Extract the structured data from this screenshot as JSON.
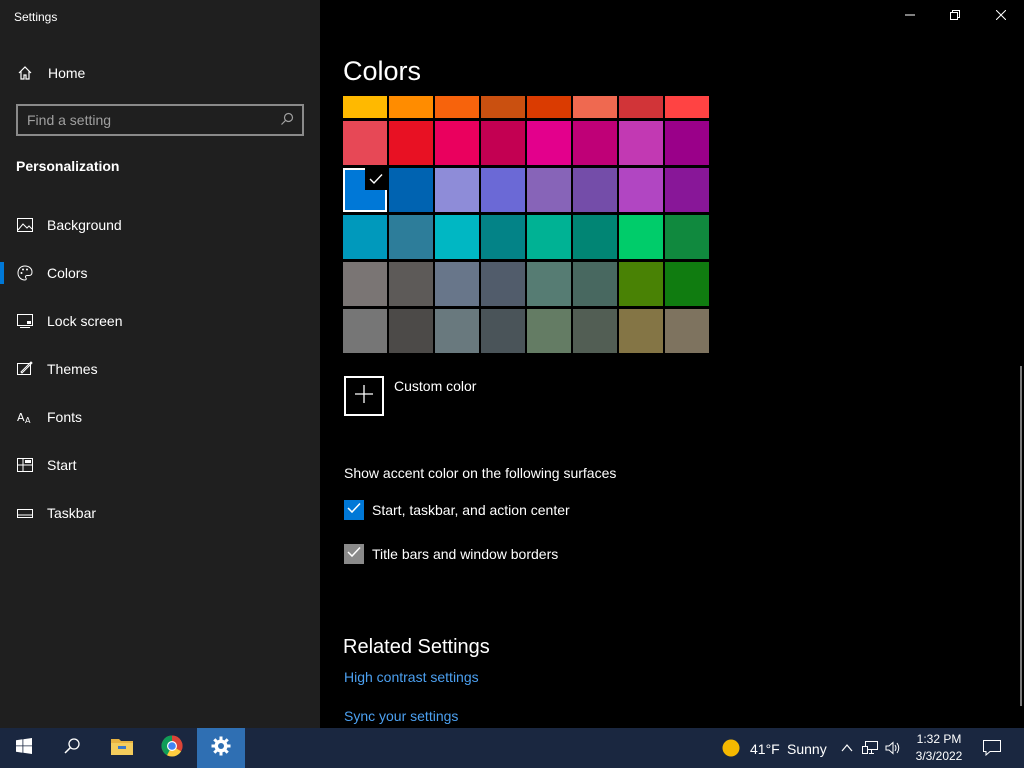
{
  "window": {
    "title": "Settings"
  },
  "sidebar": {
    "home_label": "Home",
    "search_placeholder": "Find a setting",
    "section_heading": "Personalization",
    "items": [
      {
        "label": "Background",
        "icon": "picture-icon"
      },
      {
        "label": "Colors",
        "icon": "palette-icon",
        "active": true
      },
      {
        "label": "Lock screen",
        "icon": "lock-screen-icon"
      },
      {
        "label": "Themes",
        "icon": "themes-icon"
      },
      {
        "label": "Fonts",
        "icon": "fonts-icon"
      },
      {
        "label": "Start",
        "icon": "start-icon"
      },
      {
        "label": "Taskbar",
        "icon": "taskbar-icon"
      }
    ]
  },
  "main": {
    "title": "Colors",
    "swatch_rows": [
      [
        "#FFB900",
        "#FF8C00",
        "#F7630C",
        "#CA5010",
        "#DA3B01",
        "#EF6950",
        "#D13438",
        "#FF4343"
      ],
      [
        "#E74856",
        "#E81123",
        "#EA005E",
        "#C30052",
        "#E3008C",
        "#BF0077",
        "#C239B3",
        "#9A0089"
      ],
      [
        "#0078D7",
        "#0063B1",
        "#8E8CD8",
        "#6B69D6",
        "#8764B8",
        "#744DA9",
        "#B146C2",
        "#881798"
      ],
      [
        "#0099BC",
        "#2D7D9A",
        "#00B7C3",
        "#038387",
        "#00B294",
        "#018574",
        "#00CC6A",
        "#10893E"
      ],
      [
        "#7A7574",
        "#5D5A58",
        "#68768A",
        "#515C6B",
        "#567C73",
        "#486860",
        "#498205",
        "#107C10"
      ],
      [
        "#767676",
        "#4C4A48",
        "#69797E",
        "#4A5459",
        "#647C64",
        "#525E54",
        "#847545",
        "#7E735F"
      ]
    ],
    "selected_swatch": "#0078D7",
    "custom_color_label": "Custom color",
    "surfaces_heading": "Show accent color on the following surfaces",
    "checkboxes": [
      {
        "label": "Start, taskbar, and action center",
        "checked": true
      },
      {
        "label": "Title bars and window borders",
        "checked": true
      }
    ],
    "related_heading": "Related Settings",
    "links": [
      "High contrast settings",
      "Sync your settings"
    ]
  },
  "taskbar": {
    "weather_temp": "41°F",
    "weather_condition": "Sunny",
    "time": "1:32 PM",
    "date": "3/3/2022"
  },
  "colors": {
    "accent": "#0078D7",
    "link": "#4CA0F0",
    "sidebar_bg": "#1F1F1F",
    "taskbar_bg": "#1A2740"
  }
}
